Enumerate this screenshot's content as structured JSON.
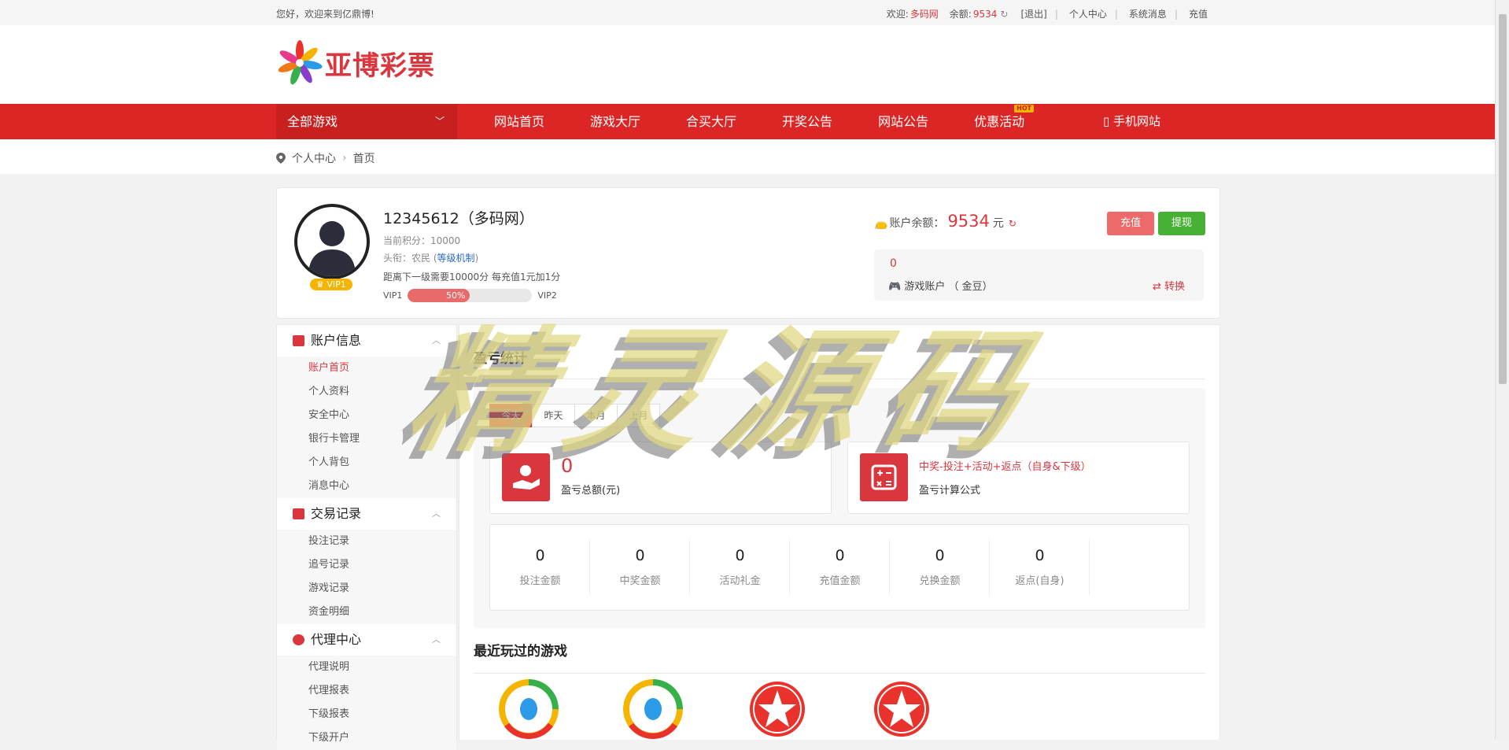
{
  "topbar": {
    "greeting": "您好，欢迎来到亿鼎博!",
    "welcome_label": "欢迎:",
    "welcome_user": "多码网",
    "balance_label": "余额:",
    "balance_value": "9534",
    "logout": "[退出]",
    "user_center": "个人中心",
    "messages": "系统消息",
    "recharge": "充值"
  },
  "logo": {
    "title": "亚博彩票"
  },
  "nav": {
    "all_games": "全部游戏",
    "items": [
      "网站首页",
      "游戏大厅",
      "合买大厅",
      "开奖公告",
      "网站公告",
      "优惠活动"
    ],
    "hot_badge": "HOT",
    "mobile": "手机网站"
  },
  "breadcrumb": {
    "items": [
      "个人中心",
      "首页"
    ]
  },
  "profile": {
    "username": "12345612（多码网）",
    "points": "当前积分：10000",
    "title_prefix": "头衔：农民 (",
    "title_link": "等级机制",
    "title_suffix": ")",
    "next_level": "距离下一级需要10000分 每充值1元加1分",
    "vip_from": "VIP1",
    "vip_to": "VIP2",
    "vip_badge": "VIP1",
    "progress_label": "50%",
    "progress": 0.5,
    "balance_label": "账户余额：",
    "balance": "9534",
    "balance_unit": "元",
    "btn_recharge": "充值",
    "btn_withdraw": "提现",
    "game_account_value": "0",
    "game_account_label": "游戏账户 （ 金豆）",
    "convert": "转换"
  },
  "sidebar": {
    "sections": [
      {
        "title": "账户信息",
        "items": [
          "账户首页",
          "个人资料",
          "安全中心",
          "银行卡管理",
          "个人背包",
          "消息中心"
        ]
      },
      {
        "title": "交易记录",
        "items": [
          "投注记录",
          "追号记录",
          "游戏记录",
          "资金明细"
        ]
      },
      {
        "title": "代理中心",
        "items": [
          "代理说明",
          "代理报表",
          "下级报表",
          "下级开户"
        ]
      }
    ]
  },
  "stats": {
    "title": "盈亏统计",
    "tabs": [
      "今天",
      "昨天",
      "本月",
      "上月"
    ],
    "total_value": "0",
    "total_label": "盈亏总额(元)",
    "formula": "中奖-投注+活动+返点（自身&下级）",
    "formula_label": "盈亏计算公式",
    "cells": [
      {
        "value": "0",
        "label": "投注金额"
      },
      {
        "value": "0",
        "label": "中奖金额"
      },
      {
        "value": "0",
        "label": "活动礼金"
      },
      {
        "value": "0",
        "label": "充值金额"
      },
      {
        "value": "0",
        "label": "兑换金额"
      },
      {
        "value": "0",
        "label": "返点(自身)"
      }
    ]
  },
  "recent": {
    "title": "最近玩过的游戏"
  },
  "watermark": "精灵源码",
  "colors": {
    "brand_red": "#dc2626",
    "green": "#47b035",
    "gold": "#f5b400"
  }
}
